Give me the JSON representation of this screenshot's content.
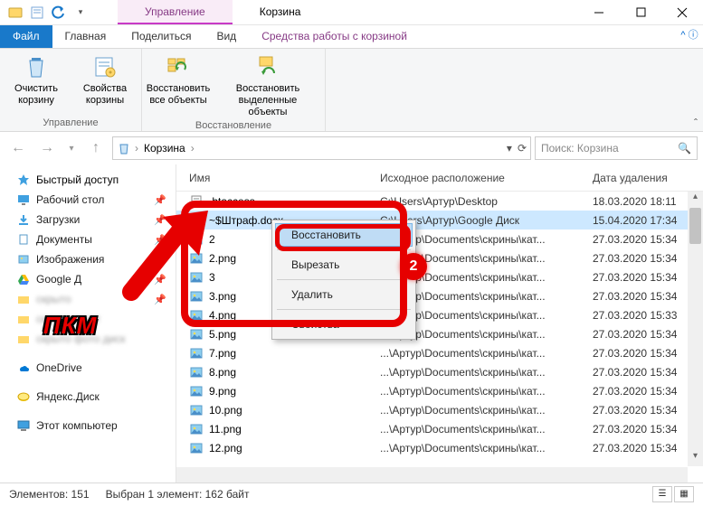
{
  "titlebar": {
    "manage_tab": "Управление",
    "window_title": "Корзина"
  },
  "tabs": {
    "file": "Файл",
    "home": "Главная",
    "share": "Поделиться",
    "view": "Вид",
    "recycle_tools": "Средства работы с корзиной"
  },
  "ribbon": {
    "empty_bin": "Очистить корзину",
    "bin_props": "Свойства корзины",
    "restore_all": "Восстановить все объекты",
    "restore_sel": "Восстановить выделенные объекты",
    "group_manage": "Управление",
    "group_restore": "Восстановление"
  },
  "address": {
    "crumb1": "Корзина",
    "search_placeholder": "Поиск: Корзина"
  },
  "nav": {
    "quick": "Быстрый доступ",
    "desktop": "Рабочий стол",
    "downloads": "Загрузки",
    "documents": "Документы",
    "pictures": "Изображения",
    "gdrive": "Google Д",
    "blur1": "скрыто",
    "blur2": "скрыто текст",
    "blur3": "скрыто фото диск",
    "onedrive": "OneDrive",
    "yadisk": "Яндекс.Диск",
    "thispc": "Этот компьютер"
  },
  "columns": {
    "name": "Имя",
    "loc": "Исходное расположение",
    "date": "Дата удаления"
  },
  "files": [
    {
      "name": ".htaccess",
      "loc": "C:\\Users\\Артур\\Desktop",
      "date": "18.03.2020 18:11",
      "icon": "txt"
    },
    {
      "name": "~$Штраф.docx",
      "loc": "C:\\Users\\Артур\\Google Диск",
      "date": "15.04.2020 17:34",
      "icon": "doc",
      "sel": true
    },
    {
      "name": "2",
      "loc": "...\\Артур\\Documents\\скрины\\кат...",
      "date": "27.03.2020 15:34",
      "icon": "img"
    },
    {
      "name": "2.png",
      "loc": "...\\Артур\\Documents\\скрины\\кат...",
      "date": "27.03.2020 15:34",
      "icon": "img"
    },
    {
      "name": "3",
      "loc": "...\\Артур\\Documents\\скрины\\кат...",
      "date": "27.03.2020 15:34",
      "icon": "img"
    },
    {
      "name": "3.png",
      "loc": "...\\Артур\\Documents\\скрины\\кат...",
      "date": "27.03.2020 15:34",
      "icon": "img"
    },
    {
      "name": "4.png",
      "loc": "...\\Артур\\Documents\\скрины\\кат...",
      "date": "27.03.2020 15:33",
      "icon": "img"
    },
    {
      "name": "5.png",
      "loc": "...\\Артур\\Documents\\скрины\\кат...",
      "date": "27.03.2020 15:34",
      "icon": "img"
    },
    {
      "name": "7.png",
      "loc": "...\\Артур\\Documents\\скрины\\кат...",
      "date": "27.03.2020 15:34",
      "icon": "img"
    },
    {
      "name": "8.png",
      "loc": "...\\Артур\\Documents\\скрины\\кат...",
      "date": "27.03.2020 15:34",
      "icon": "img"
    },
    {
      "name": "9.png",
      "loc": "...\\Артур\\Documents\\скрины\\кат...",
      "date": "27.03.2020 15:34",
      "icon": "img"
    },
    {
      "name": "10.png",
      "loc": "...\\Артур\\Documents\\скрины\\кат...",
      "date": "27.03.2020 15:34",
      "icon": "img"
    },
    {
      "name": "11.png",
      "loc": "...\\Артур\\Documents\\скрины\\кат...",
      "date": "27.03.2020 15:34",
      "icon": "img"
    },
    {
      "name": "12.png",
      "loc": "...\\Артур\\Documents\\скрины\\кат...",
      "date": "27.03.2020 15:34",
      "icon": "img"
    }
  ],
  "context": {
    "restore": "Восстановить",
    "cut": "Вырезать",
    "delete": "Удалить",
    "props": "Свойства"
  },
  "annot": {
    "pkm": "ПКМ",
    "badge": "2"
  },
  "status": {
    "count": "Элементов: 151",
    "sel": "Выбран 1 элемент: 162 байт"
  }
}
